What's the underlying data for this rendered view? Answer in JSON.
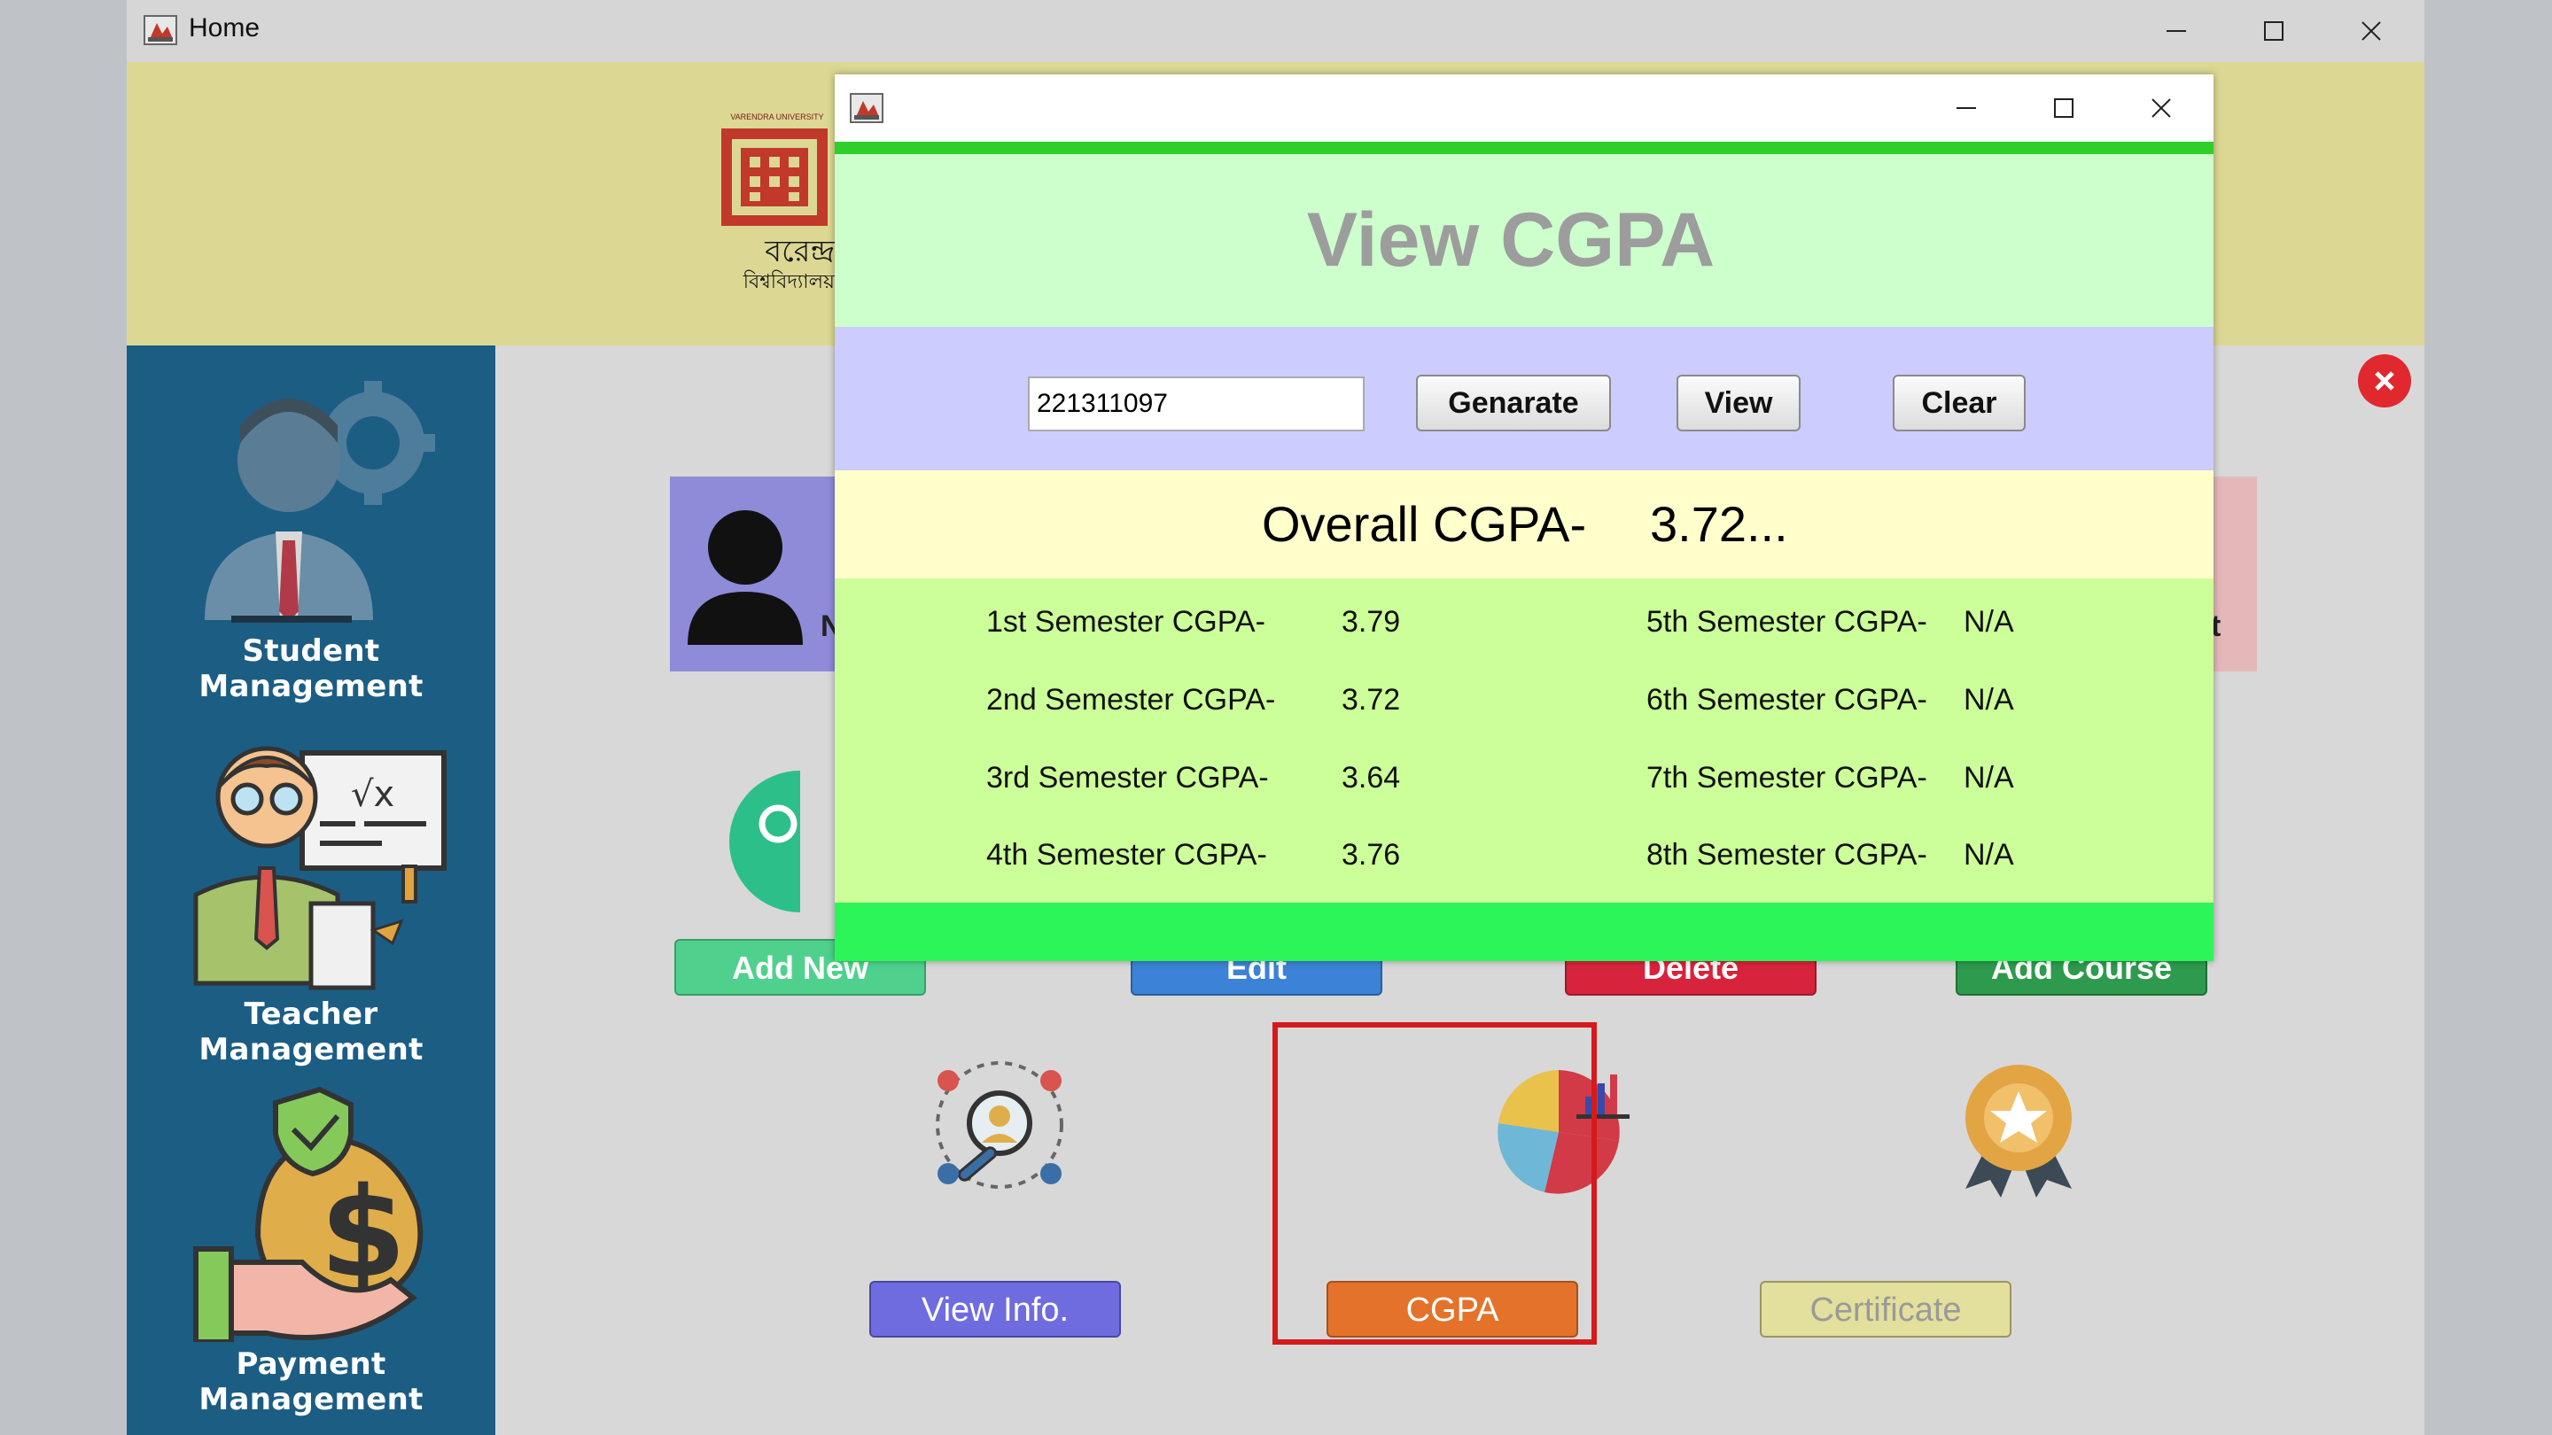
{
  "main_window": {
    "title": "Home",
    "controls": {
      "minimize": "minimize-icon",
      "maximize": "maximize-icon",
      "close": "close-icon"
    }
  },
  "header": {
    "logo_top_text": "VARENDRA UNIVERSITY",
    "logo_bengali_line1": "বরেন্দ্র",
    "logo_bengali_line2": "বিশ্ববিদ্যালয়"
  },
  "sidebar": {
    "items": [
      {
        "label": "Student Management",
        "icon": "student-management-icon"
      },
      {
        "label": "Teacher Management",
        "icon": "teacher-management-icon"
      },
      {
        "label": "Payment Management",
        "icon": "payment-management-icon"
      }
    ]
  },
  "background_buttons": {
    "add_new": "Add New",
    "edit": "Edit",
    "delete": "Delete",
    "add_course": "Add Course",
    "partial_letter_left": "N",
    "partial_letter_right": "t"
  },
  "bottom_actions": {
    "view_info": "View Info.",
    "cgpa": "CGPA",
    "certificate": "Certificate"
  },
  "dialog": {
    "title": "View CGPA",
    "student_id": "221311097",
    "buttons": {
      "generate": "Genarate",
      "view": "View",
      "clear": "Clear"
    },
    "overall_label": "Overall CGPA-",
    "overall_value": "3.72...",
    "semesters": [
      {
        "label": "1st Semester CGPA-",
        "value": "3.79"
      },
      {
        "label": "2nd Semester CGPA-",
        "value": "3.72"
      },
      {
        "label": "3rd Semester CGPA-",
        "value": "3.64"
      },
      {
        "label": "4th Semester CGPA-",
        "value": "3.76"
      },
      {
        "label": "5th Semester CGPA-",
        "value": "N/A"
      },
      {
        "label": "6th Semester CGPA-",
        "value": "N/A"
      },
      {
        "label": "7th Semester CGPA-",
        "value": "N/A"
      },
      {
        "label": "8th Semester CGPA-",
        "value": "N/A"
      }
    ]
  },
  "colors": {
    "sidebar": "#1c5d84",
    "header_band": "#dcd893",
    "dialog_title_bg": "#ccffcc",
    "dialog_search_bg": "#ccccff",
    "overall_bg": "#ffffcc",
    "semester_bg": "#ccff99",
    "footer_green": "#2cf55a",
    "highlight": "#d41a1a",
    "cgpa_button": "#e5722a"
  }
}
